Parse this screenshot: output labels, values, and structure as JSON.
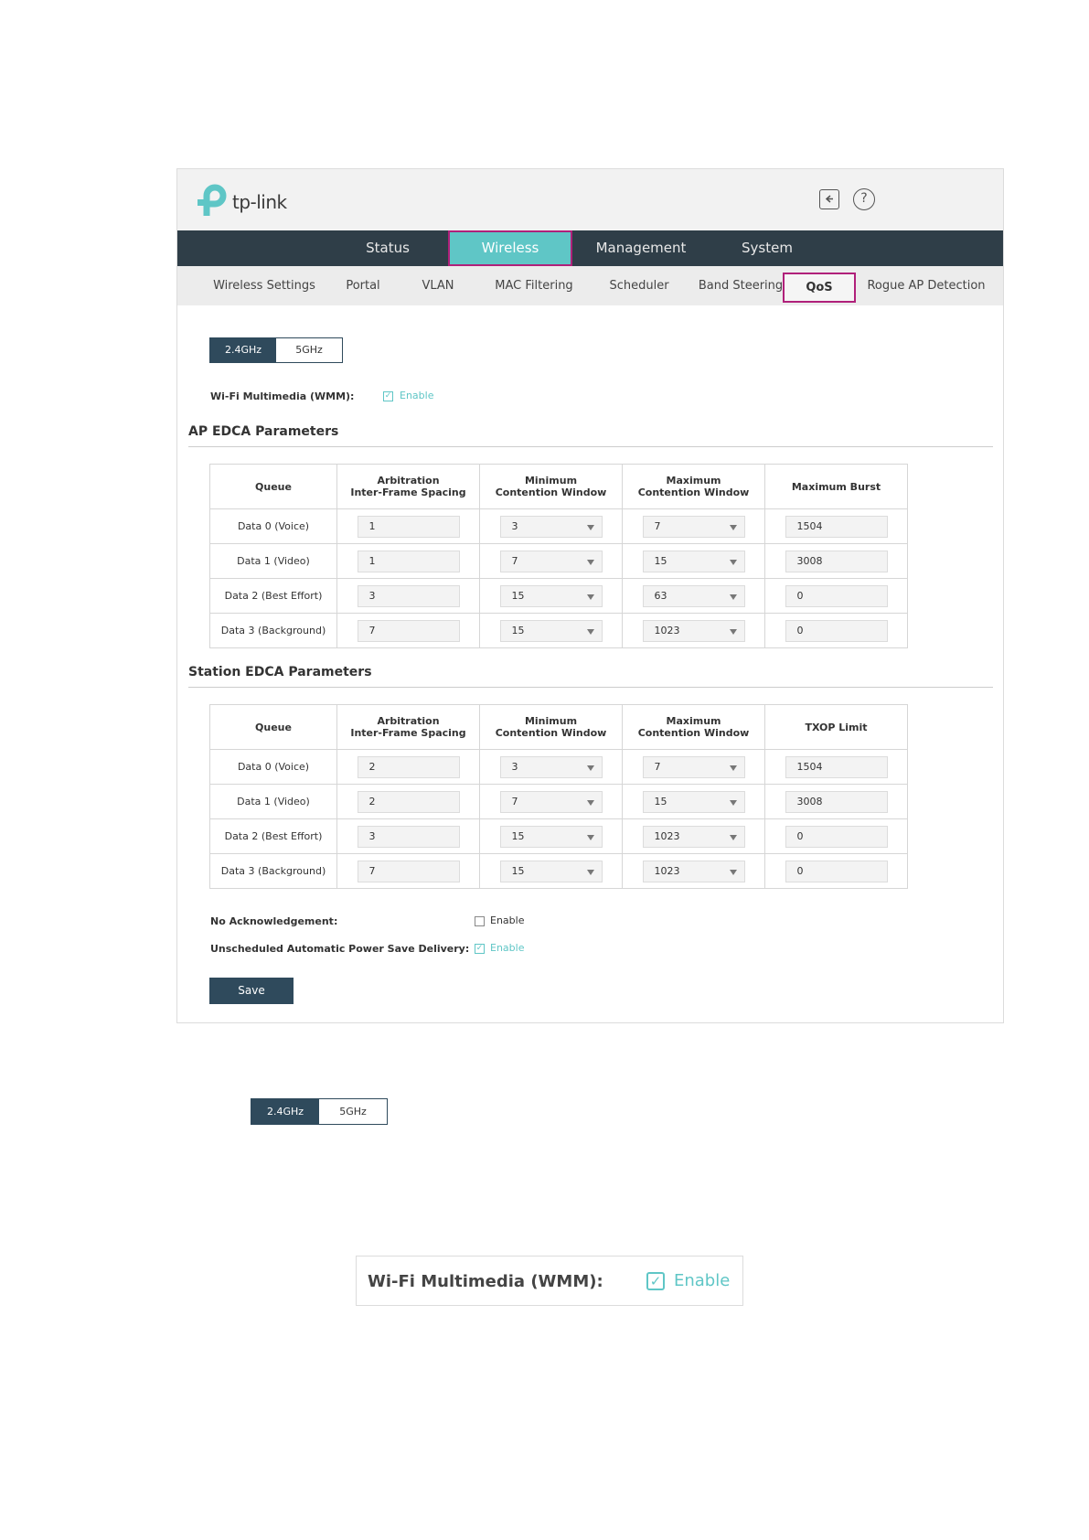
{
  "brand": {
    "logo_text": "tp-link",
    "logo_color": "#5fc6c6",
    "nav_bg": "#2f3e48",
    "accent": "#5fc6c6",
    "highlight": "#b0207a"
  },
  "header": {
    "icons": [
      "logout-icon",
      "help-icon"
    ],
    "help_glyph": "?"
  },
  "main_nav": [
    "Status",
    "Wireless",
    "Management",
    "System"
  ],
  "sub_nav": [
    "Wireless Settings",
    "Portal",
    "VLAN",
    "MAC Filtering",
    "Scheduler",
    "Band Steering",
    "QoS",
    "Rogue AP Detection"
  ],
  "band": {
    "on": "2.4GHz",
    "off": "5GHz"
  },
  "wmm": {
    "label": "Wi-Fi Multimedia (WMM):",
    "enable": "Enable",
    "checked": true
  },
  "ap": {
    "title": "AP EDCA Parameters",
    "headers": [
      "Queue",
      "Arbitration\nInter-Frame Spacing",
      "Minimum\nContention Window",
      "Maximum\nContention Window",
      "Maximum Burst"
    ],
    "rows": [
      {
        "queue": "Data 0 (Voice)",
        "aifs": "1",
        "cwmin": "3",
        "cwmax": "7",
        "burst": "1504"
      },
      {
        "queue": "Data 1 (Video)",
        "aifs": "1",
        "cwmin": "7",
        "cwmax": "15",
        "burst": "3008"
      },
      {
        "queue": "Data 2 (Best Effort)",
        "aifs": "3",
        "cwmin": "15",
        "cwmax": "63",
        "burst": "0"
      },
      {
        "queue": "Data 3 (Background)",
        "aifs": "7",
        "cwmin": "15",
        "cwmax": "1023",
        "burst": "0"
      }
    ]
  },
  "station": {
    "title": "Station EDCA Parameters",
    "headers": [
      "Queue",
      "Arbitration\nInter-Frame Spacing",
      "Minimum\nContention Window",
      "Maximum\nContention Window",
      "TXOP Limit"
    ],
    "rows": [
      {
        "queue": "Data 0 (Voice)",
        "aifs": "2",
        "cwmin": "3",
        "cwmax": "7",
        "txop": "1504"
      },
      {
        "queue": "Data 1 (Video)",
        "aifs": "2",
        "cwmin": "7",
        "cwmax": "15",
        "txop": "3008"
      },
      {
        "queue": "Data 2 (Best Effort)",
        "aifs": "3",
        "cwmin": "15",
        "cwmax": "1023",
        "txop": "0"
      },
      {
        "queue": "Data 3 (Background)",
        "aifs": "7",
        "cwmin": "15",
        "cwmax": "1023",
        "txop": "0"
      }
    ]
  },
  "no_ack": {
    "label": "No Acknowledgement:",
    "enable": "Enable",
    "checked": false
  },
  "uapsd": {
    "label": "Unscheduled Automatic Power Save Delivery:",
    "enable": "Enable",
    "checked": true
  },
  "save_label": "Save",
  "zoom_band": {
    "on": "2.4GHz",
    "off": "5GHz"
  },
  "zoom_wmm": {
    "label": "Wi-Fi Multimedia (WMM):",
    "enable": "Enable"
  }
}
